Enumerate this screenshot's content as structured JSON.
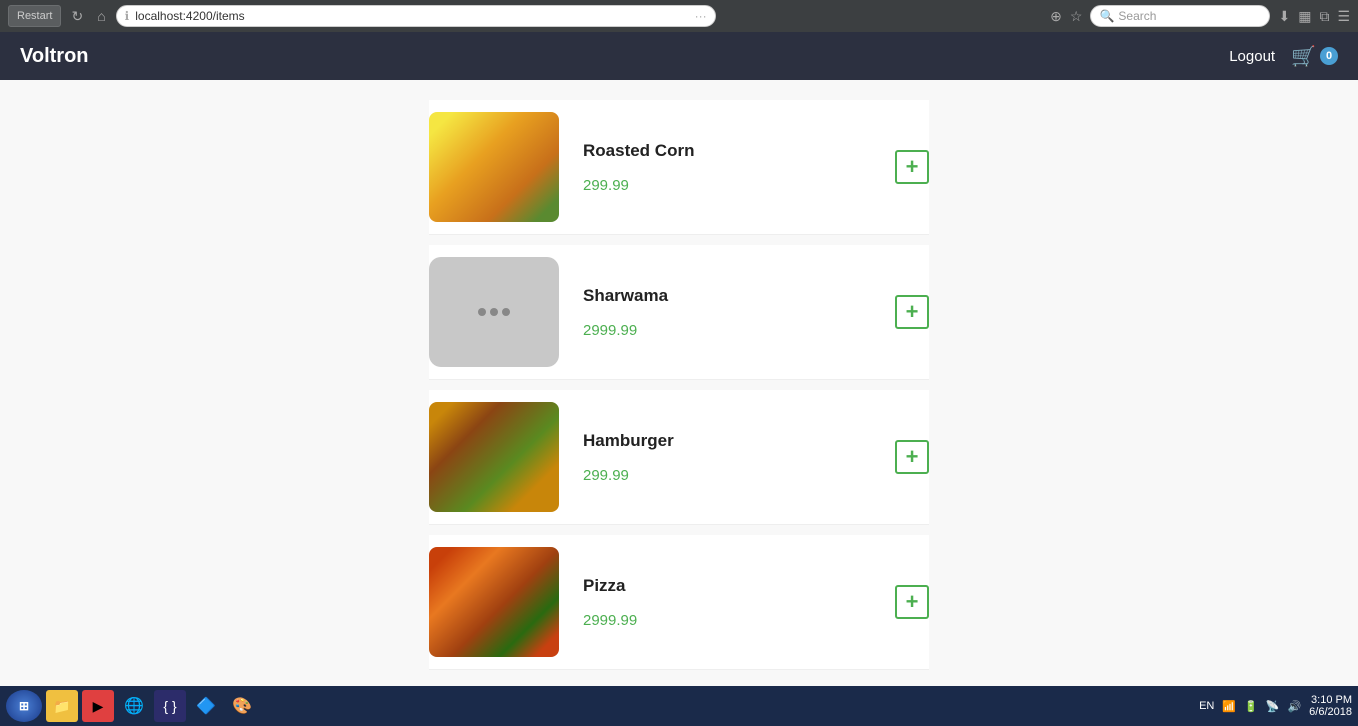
{
  "browser": {
    "restart_label": "Restart",
    "address": "localhost:4200/items",
    "search_placeholder": "Search",
    "address_dots": "···"
  },
  "app": {
    "brand": "Voltron",
    "logout_label": "Logout",
    "cart_count": "0"
  },
  "items": [
    {
      "id": "roasted-corn",
      "name": "Roasted Corn",
      "price": "299.99",
      "image_type": "roasted-corn",
      "add_label": "+"
    },
    {
      "id": "sharwama",
      "name": "Sharwama",
      "price": "2999.99",
      "image_type": "placeholder",
      "add_label": "+"
    },
    {
      "id": "hamburger",
      "name": "Hamburger",
      "price": "299.99",
      "image_type": "hamburger",
      "add_label": "+"
    },
    {
      "id": "pizza",
      "name": "Pizza",
      "price": "2999.99",
      "image_type": "pizza",
      "add_label": "+"
    }
  ],
  "taskbar": {
    "time": "3:10 PM",
    "date": "6/6/2018",
    "lang": "EN"
  }
}
